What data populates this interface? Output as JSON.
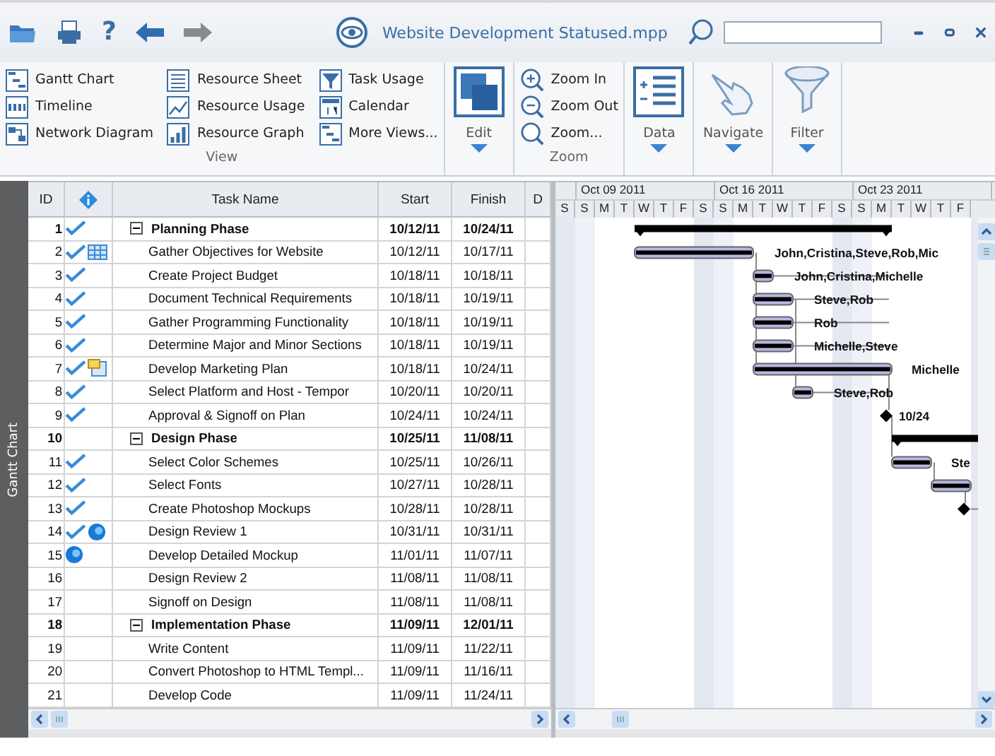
{
  "title_bar": {
    "help_glyph": "?",
    "title": "Website Development Statused.mpp"
  },
  "ribbon": {
    "groups": [
      {
        "kind": "list",
        "label": "View",
        "items": [
          "Gantt Chart",
          "Timeline",
          "Network Diagram",
          "Resource Sheet",
          "Resource Usage",
          "Resource Graph",
          "Task Usage",
          "Calendar",
          "More Views..."
        ]
      },
      {
        "kind": "big",
        "label": "Edit"
      },
      {
        "kind": "list",
        "label": "Zoom",
        "items": [
          "Zoom In",
          "Zoom Out",
          "Zoom..."
        ]
      },
      {
        "kind": "big",
        "label": "Data"
      },
      {
        "kind": "big",
        "label": "Navigate"
      },
      {
        "kind": "big",
        "label": "Filter"
      }
    ]
  },
  "side_rail": {
    "label": "Gantt Chart"
  },
  "table": {
    "columns": [
      {
        "kind": "text",
        "label": "ID"
      },
      {
        "kind": "icon"
      },
      {
        "kind": "text",
        "label": "Task Name"
      },
      {
        "kind": "text",
        "label": "Start"
      },
      {
        "kind": "text",
        "label": "Finish"
      },
      {
        "kind": "text",
        "label": "D"
      }
    ],
    "rows": [
      {
        "id": "1",
        "name": "Planning Phase",
        "start": "10/12/11",
        "finish": "10/24/11",
        "kind": "summary",
        "expanded": true,
        "complete": true
      },
      {
        "id": "2",
        "name": "Gather Objectives for Website",
        "start": "10/12/11",
        "finish": "10/17/11",
        "kind": "task",
        "complete": true,
        "indicator": {
          "kind": "table"
        }
      },
      {
        "id": "3",
        "name": "Create Project Budget",
        "start": "10/18/11",
        "finish": "10/18/11",
        "kind": "task",
        "complete": true
      },
      {
        "id": "4",
        "name": "Document Technical Requirements",
        "start": "10/18/11",
        "finish": "10/19/11",
        "kind": "task",
        "complete": true
      },
      {
        "id": "5",
        "name": "Gather Programming Functionality",
        "start": "10/18/11",
        "finish": "10/19/11",
        "kind": "task",
        "complete": true
      },
      {
        "id": "6",
        "name": "Determine Major and Minor Sections",
        "start": "10/18/11",
        "finish": "10/19/11",
        "kind": "task",
        "complete": true
      },
      {
        "id": "7",
        "name": "Develop Marketing Plan",
        "start": "10/18/11",
        "finish": "10/24/11",
        "kind": "task",
        "complete": true,
        "indicator": {
          "kind": "note"
        }
      },
      {
        "id": "8",
        "name": "Select Platform and Host - Tempor",
        "start": "10/20/11",
        "finish": "10/20/11",
        "kind": "task",
        "complete": true
      },
      {
        "id": "9",
        "name": "Approval & Signoff on Plan",
        "start": "10/24/11",
        "finish": "10/24/11",
        "kind": "task",
        "complete": true
      },
      {
        "id": "10",
        "name": "Design Phase",
        "start": "10/25/11",
        "finish": "11/08/11",
        "kind": "summary",
        "expanded": true,
        "complete": false
      },
      {
        "id": "11",
        "name": "Select Color Schemes",
        "start": "10/25/11",
        "finish": "10/26/11",
        "kind": "task",
        "complete": true
      },
      {
        "id": "12",
        "name": "Select Fonts",
        "start": "10/27/11",
        "finish": "10/28/11",
        "kind": "task",
        "complete": true
      },
      {
        "id": "13",
        "name": "Create Photoshop Mockups",
        "start": "10/28/11",
        "finish": "10/28/11",
        "kind": "task",
        "complete": true
      },
      {
        "id": "14",
        "name": "Design Review 1",
        "start": "10/31/11",
        "finish": "10/31/11",
        "kind": "task",
        "complete": true,
        "indicator": {
          "kind": "globe"
        }
      },
      {
        "id": "15",
        "name": "Develop Detailed Mockup",
        "start": "11/01/11",
        "finish": "11/07/11",
        "kind": "task",
        "complete": false,
        "indicator": {
          "kind": "globe"
        }
      },
      {
        "id": "16",
        "name": "Design Review 2",
        "start": "11/08/11",
        "finish": "11/08/11",
        "kind": "task",
        "complete": false
      },
      {
        "id": "17",
        "name": "Signoff on Design",
        "start": "11/08/11",
        "finish": "11/08/11",
        "kind": "task",
        "complete": false
      },
      {
        "id": "18",
        "name": "Implementation Phase",
        "start": "11/09/11",
        "finish": "12/01/11",
        "kind": "summary",
        "expanded": true,
        "complete": false
      },
      {
        "id": "19",
        "name": "Write Content",
        "start": "11/09/11",
        "finish": "11/22/11",
        "kind": "task",
        "complete": false
      },
      {
        "id": "20",
        "name": "Convert Photoshop to HTML Templ...",
        "start": "11/09/11",
        "finish": "11/16/11",
        "kind": "task",
        "complete": false
      },
      {
        "id": "21",
        "name": "Develop Code",
        "start": "11/09/11",
        "finish": "11/24/11",
        "kind": "task",
        "complete": false
      }
    ]
  },
  "gantt": {
    "weeks": [
      "Oct 09 2011",
      "Oct 16 2011",
      "Oct 23 2011"
    ],
    "days": [
      "S",
      "S",
      "M",
      "T",
      "W",
      "T",
      "F",
      "S",
      "S",
      "M",
      "T",
      "W",
      "T",
      "F",
      "S",
      "S",
      "M",
      "T",
      "W",
      "T",
      "F"
    ],
    "bar_labels": [
      "John,Cristina,Steve,Rob,Mic",
      "John,Cristina,Michelle",
      "Steve,Rob",
      "Rob",
      "Michelle,Steve",
      "Michelle",
      "Steve,Rob",
      "10/24",
      "Ste"
    ]
  }
}
